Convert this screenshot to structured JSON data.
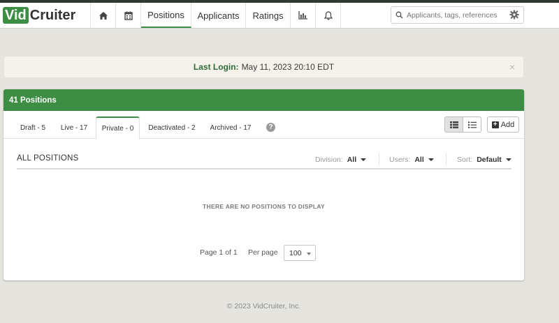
{
  "brand": {
    "part1": "Vid",
    "part2": "Cruiter",
    "accent": "#3d8e44"
  },
  "nav": {
    "icons": [
      "home-icon",
      "calendar-icon",
      "chart-icon",
      "bell-icon"
    ],
    "items": [
      {
        "label": "Positions",
        "active": true
      },
      {
        "label": "Applicants",
        "active": false
      },
      {
        "label": "Ratings",
        "active": false
      }
    ]
  },
  "search": {
    "placeholder": "Applicants, tags, references",
    "value": ""
  },
  "alert": {
    "label": "Last Login:",
    "text": "May 11, 2023 20:10 EDT",
    "close": "×"
  },
  "panel": {
    "title": "41 Positions",
    "tabs": [
      {
        "label": "Draft - 5",
        "active": false
      },
      {
        "label": "Live - 17",
        "active": false
      },
      {
        "label": "Private - 0",
        "active": true
      },
      {
        "label": "Deactivated - 2",
        "active": false
      },
      {
        "label": "Archived - 17",
        "active": false
      }
    ],
    "help": "?",
    "add_label": "Add",
    "section_title": "ALL POSITIONS",
    "filters": {
      "division": {
        "label": "Division:",
        "value": "All"
      },
      "users": {
        "label": "Users:",
        "value": "All"
      },
      "sort": {
        "label": "Sort:",
        "value": "Default"
      }
    },
    "empty_message": "THERE ARE NO POSITIONS TO DISPLAY",
    "pager": {
      "page_text": "Page 1 of 1",
      "per_page_label": "Per page",
      "per_page_value": "100"
    }
  },
  "footer": "© 2023 VidCruiter, Inc."
}
